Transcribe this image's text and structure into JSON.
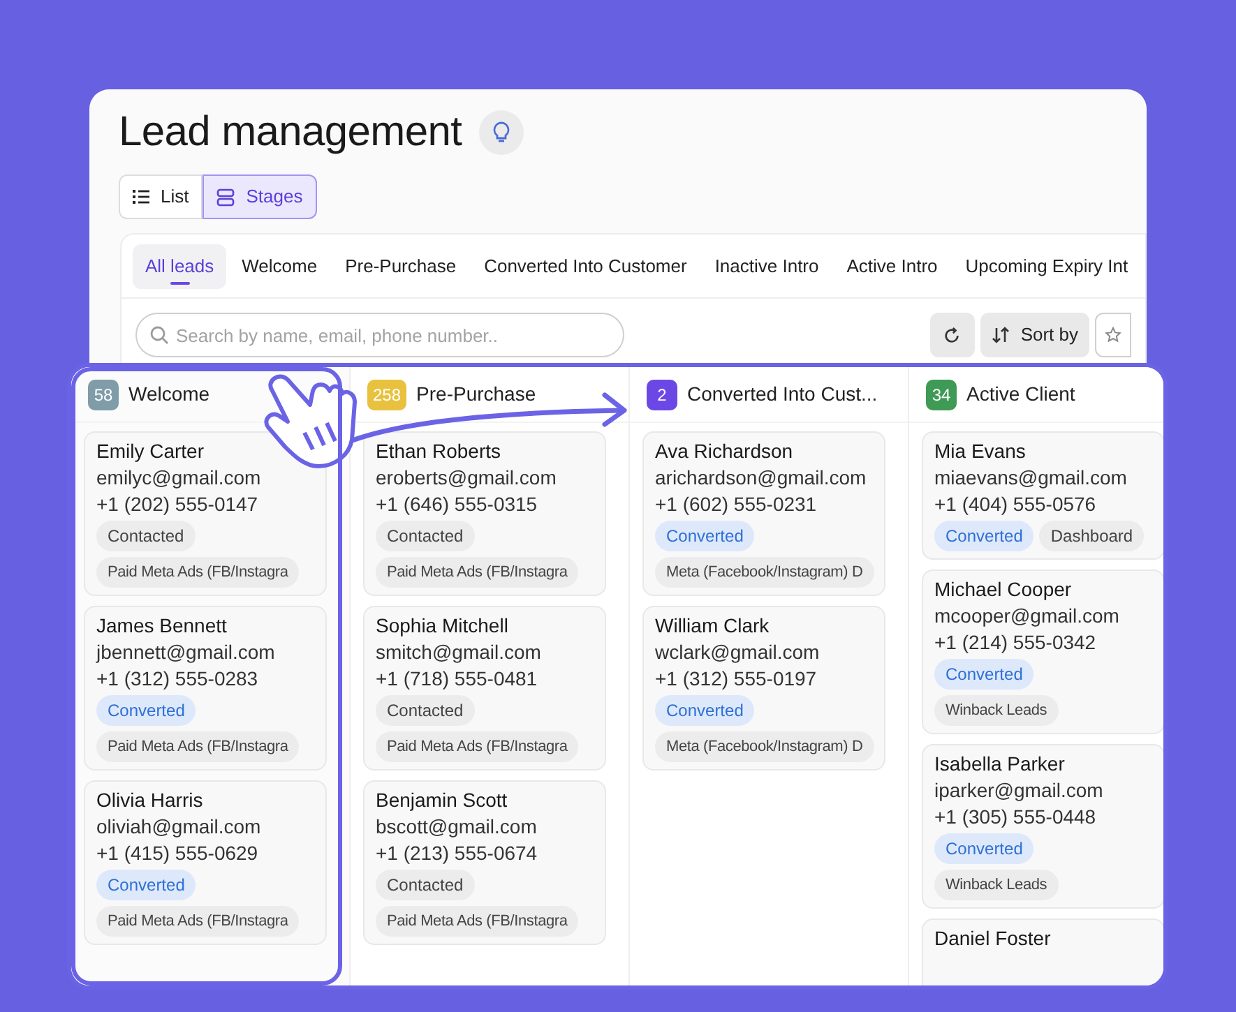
{
  "title": "Lead management",
  "view_toggle": [
    {
      "label": "List",
      "selected": false
    },
    {
      "label": "Stages",
      "selected": true
    }
  ],
  "tabs": [
    {
      "label": "All leads",
      "selected": true
    },
    {
      "label": "Welcome",
      "selected": false
    },
    {
      "label": "Pre-Purchase",
      "selected": false
    },
    {
      "label": "Converted Into Customer",
      "selected": false
    },
    {
      "label": "Inactive Intro",
      "selected": false
    },
    {
      "label": "Active Intro",
      "selected": false
    },
    {
      "label": "Upcoming Expiry Int",
      "selected": false
    }
  ],
  "search": {
    "placeholder": "Search by name, email, phone number.."
  },
  "sort_button": "Sort by",
  "columns": [
    {
      "count": "58",
      "color": "#7f9ca8",
      "title": "Welcome",
      "highlighted": true,
      "cards": [
        {
          "name": "Emily Carter",
          "email": "emilyc@gmail.com",
          "phone": "+1 (202) 555-0147",
          "tags": [
            {
              "text": "Contacted",
              "kind": "gray"
            }
          ],
          "source": "Paid Meta Ads (FB/Instagra"
        },
        {
          "name": "James Bennett",
          "email": "jbennett@gmail.com",
          "phone": "+1 (312) 555-0283",
          "tags": [
            {
              "text": "Converted",
              "kind": "blue"
            }
          ],
          "source": "Paid Meta Ads (FB/Instagra"
        },
        {
          "name": "Olivia Harris",
          "email": "oliviah@gmail.com",
          "phone": "+1 (415) 555-0629",
          "tags": [
            {
              "text": "Converted",
              "kind": "blue"
            }
          ],
          "source": "Paid Meta Ads (FB/Instagra"
        }
      ]
    },
    {
      "count": "258",
      "color": "#e8c23e",
      "title": "Pre-Purchase",
      "highlighted": false,
      "cards": [
        {
          "name": "Ethan Roberts",
          "email": "eroberts@gmail.com",
          "phone": "+1 (646) 555-0315",
          "tags": [
            {
              "text": "Contacted",
              "kind": "gray"
            }
          ],
          "source": "Paid Meta Ads (FB/Instagra"
        },
        {
          "name": "Sophia Mitchell",
          "email": "smitch@gmail.com",
          "phone": "+1 (718) 555-0481",
          "tags": [
            {
              "text": "Contacted",
              "kind": "gray"
            }
          ],
          "source": "Paid Meta Ads (FB/Instagra"
        },
        {
          "name": "Benjamin Scott",
          "email": "bscott@gmail.com",
          "phone": "+1 (213) 555-0674",
          "tags": [
            {
              "text": "Contacted",
              "kind": "gray"
            }
          ],
          "source": "Paid Meta Ads (FB/Instagra"
        }
      ]
    },
    {
      "count": "2",
      "color": "#6b48e6",
      "title": "Converted Into Cust...",
      "highlighted": false,
      "cards": [
        {
          "name": "Ava Richardson",
          "email": "arichardson@gmail.com",
          "phone": "+1 (602) 555-0231",
          "tags": [
            {
              "text": "Converted",
              "kind": "blue"
            }
          ],
          "source": "Meta (Facebook/Instagram) D"
        },
        {
          "name": "William Clark",
          "email": "wclark@gmail.com",
          "phone": "+1 (312) 555-0197",
          "tags": [
            {
              "text": "Converted",
              "kind": "blue"
            }
          ],
          "source": "Meta (Facebook/Instagram) D"
        }
      ]
    },
    {
      "count": "34",
      "color": "#3f9a55",
      "title": "Active Client",
      "highlighted": false,
      "cards": [
        {
          "name": "Mia Evans",
          "email": "miaevans@gmail.com",
          "phone": "+1 (404) 555-0576",
          "tags": [
            {
              "text": "Converted",
              "kind": "blue"
            },
            {
              "text": "Dashboard",
              "kind": "gray"
            }
          ]
        },
        {
          "name": "Michael Cooper",
          "email": "mcooper@gmail.com",
          "phone": "+1 (214) 555-0342",
          "tags": [
            {
              "text": "Converted",
              "kind": "blue"
            }
          ],
          "source": "Winback Leads"
        },
        {
          "name": "Isabella Parker",
          "email": "iparker@gmail.com",
          "phone": "+1 (305) 555-0448",
          "tags": [
            {
              "text": "Converted",
              "kind": "blue"
            }
          ],
          "source": "Winback Leads"
        },
        {
          "name": "Daniel Foster"
        }
      ]
    }
  ]
}
